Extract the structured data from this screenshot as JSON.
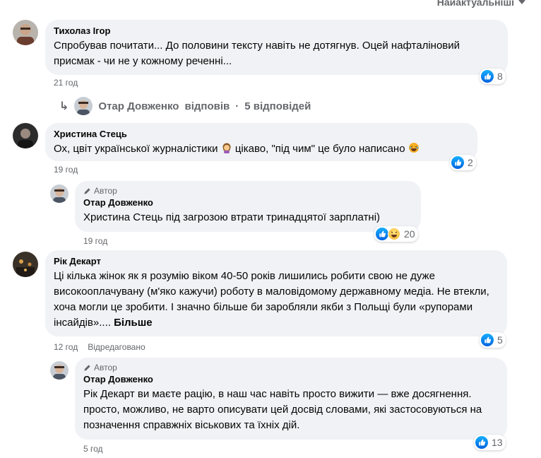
{
  "sort": {
    "label": "Найактуальніші"
  },
  "comments": [
    {
      "author": "Тихолаз Ігор",
      "text": "Спробував почитати... До половини тексту навіть не дотягнув. Оцей нафталіновий присмак - чи не у кожному реченні...",
      "time": "21 год",
      "reactions": "8"
    },
    {
      "author": "Христина Стець",
      "text_before": "Ох, цвіт української журналістики",
      "text_middle": "цікаво, \"під чим\" це було написано",
      "time": "19 год",
      "reactions": "2"
    },
    {
      "author": "Рік Декарт",
      "text": "Ці кілька жінок як я розумію віком 40-50 років лишились робити свою не дуже високооплачувану (м'яко кажучи) роботу в маловідомому державному медіа. Не втекли, хоча могли це зробити. І значно більше би заробляли якби з Польщі були «рупорами інсайдів»....",
      "more": "Більше",
      "time": "12 год",
      "edited": "Відредаговано",
      "reactions": "5"
    }
  ],
  "replies_summary": {
    "author": "Отар Довженко",
    "label": "відповів",
    "count": "5 відповідей"
  },
  "replies": [
    {
      "badge": "Автор",
      "author": "Отар Довженко",
      "text": "Христина Стець під загрозою втрати тринадцятої зарплатні)",
      "time": "19 год",
      "reactions": "20"
    },
    {
      "badge": "Автор",
      "author": "Отар Довженко",
      "text": "Рік Декарт ви маєте рацію, в наш час навіть просто вижити — вже досягнення. просто, можливо, не варто описувати цей досвід словами, які застосовуються на позначення справжніх віськових та їхніх дій.",
      "time": "5 год",
      "reactions": "13"
    }
  ],
  "colors": {
    "like_blue": "#0866ff",
    "bubble": "#f0f2f5",
    "meta": "#65676b"
  }
}
